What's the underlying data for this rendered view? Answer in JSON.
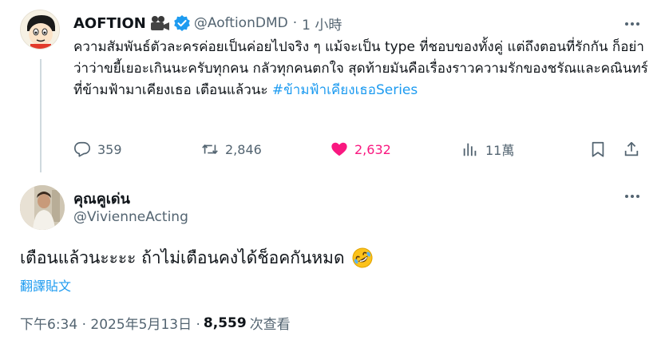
{
  "post": {
    "author": {
      "name": "AOFTION",
      "handle": "@AoftionDMD",
      "avatar_icon": "cartoon-avatar-icon",
      "badge_icon": "verified-badge-icon",
      "emoji_icon": "movie-camera-icon"
    },
    "separator": "·",
    "time": "1 小時",
    "text": "ความสัมพันธ์ตัวละครค่อยเป็นค่อยไปจริง ๆ แม้จะเป็น type ที่ชอบของทั้งคู่ แต่ถึงตอนที่รักกัน ก็อย่าว่าว่าขยี้เยอะเกินนะครับทุกคน กลัวทุกคนตกใจ สุดท้ายมันคือเรื่องราวความรักของชรัณและคณินทร์ที่ข้ามฟ้ามาเคียงเธอ เตือนแล้วนะ ",
    "hashtag": "#ข้ามฟ้าเคียงเธอSeries",
    "stats": {
      "replies": "359",
      "reposts": "2,846",
      "likes": "2,632",
      "views": "11萬"
    },
    "colors": {
      "like": "#f91880",
      "link": "#1d9bf0",
      "muted": "#536471"
    }
  },
  "reply": {
    "author": {
      "name": "คุณคูเด่น",
      "handle": "@VivienneActing",
      "avatar_icon": "user-photo-avatar-icon"
    },
    "text": "เตือนแล้วนะะะะ ถ้าไม่เตือนคงได้ช็อคกันหมด",
    "emoji_icon": "rolling-on-floor-laughing-icon",
    "translate_label": "翻譯貼文",
    "timestamp": "下午6:34 · 2025年5月13日 · ",
    "views_count": "8,559",
    "views_label": " 次查看"
  }
}
